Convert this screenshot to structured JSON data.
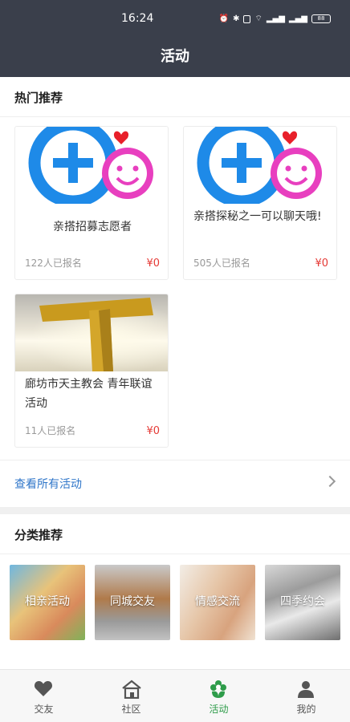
{
  "status_bar": {
    "time": "16:24",
    "battery": "88"
  },
  "header": {
    "title": "活动"
  },
  "hot": {
    "title": "热门推荐",
    "cards": [
      {
        "title": "亲搭招募志愿者",
        "count": "122人已报名",
        "price": "¥0"
      },
      {
        "title": "亲搭探秘之一可以聊天哦!",
        "count": "505人已报名",
        "price": "¥0"
      },
      {
        "title": "廊坊市天主教会 青年联谊活动",
        "count": "11人已报名",
        "price": "¥0"
      }
    ],
    "view_all": "查看所有活动"
  },
  "categories": {
    "title": "分类推荐",
    "items": [
      {
        "label": "相亲活动"
      },
      {
        "label": "同城交友"
      },
      {
        "label": "情感交流"
      },
      {
        "label": "四季约会"
      }
    ]
  },
  "tabs": [
    {
      "label": "交友",
      "icon": "heart-icon"
    },
    {
      "label": "社区",
      "icon": "home-icon"
    },
    {
      "label": "活动",
      "icon": "flower-icon",
      "active": true
    },
    {
      "label": "我的",
      "icon": "person-icon"
    }
  ],
  "colors": {
    "header_bg": "#3a3f4b",
    "accent_green": "#2e9c4a",
    "link_blue": "#2f76c9",
    "price_red": "#e53935"
  }
}
